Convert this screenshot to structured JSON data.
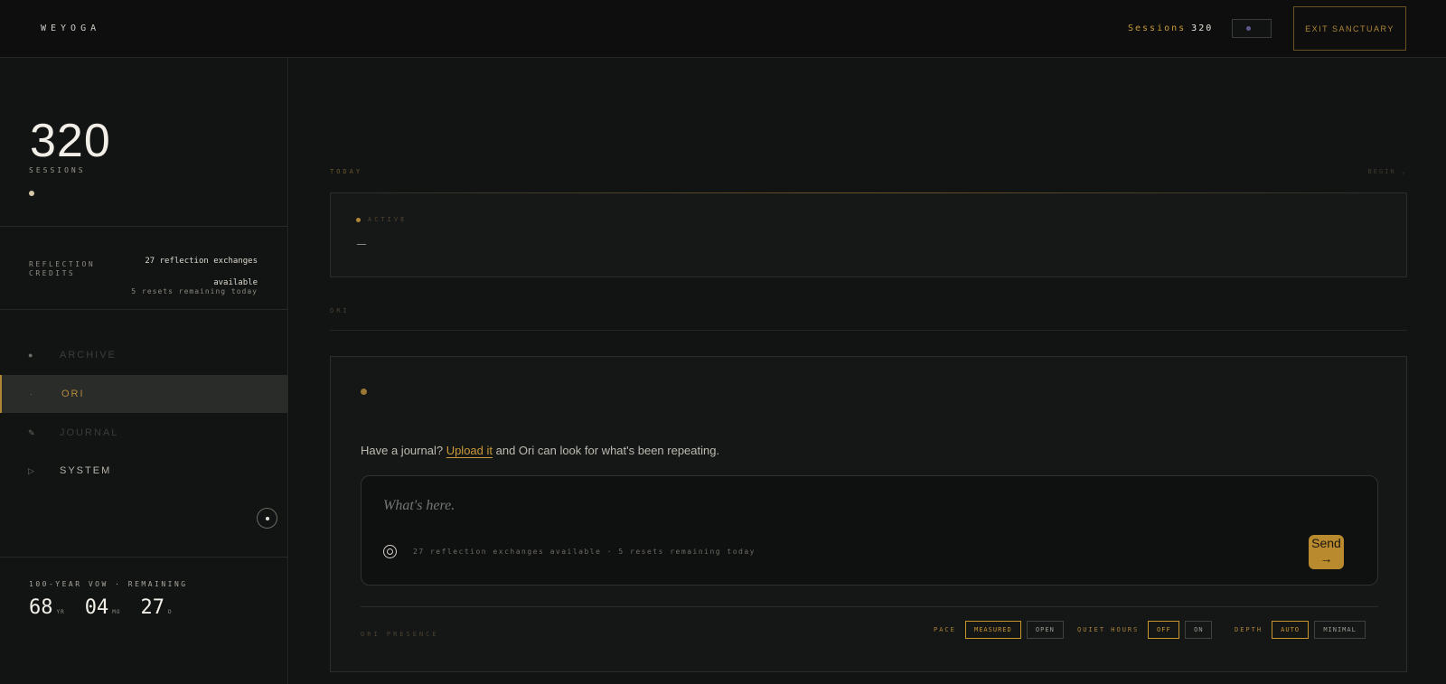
{
  "header": {
    "brand": "WEYOGA",
    "sessions_label": "Sessions",
    "sessions_value": "320",
    "exit_label": "EXIT SANCTUARY"
  },
  "sidebar": {
    "sessions_count": "320",
    "sessions_label": "SESSIONS",
    "credits": {
      "label": "REFLECTION CREDITS",
      "value": "27 reflection exchanges available",
      "resets": "5 resets remaining today"
    },
    "nav": [
      {
        "label": "ARCHIVE",
        "icon": "dot-icon",
        "state": "disabled"
      },
      {
        "label": "ORI",
        "icon": "small-dot-icon",
        "state": "active"
      },
      {
        "label": "JOURNAL",
        "icon": "pen-icon",
        "state": "disabled"
      },
      {
        "label": "SYSTEM",
        "icon": "play-icon",
        "state": "normal"
      }
    ],
    "vow": {
      "label": "100-YEAR VOW · REMAINING",
      "years": "68",
      "years_unit": "YR",
      "months": "04",
      "months_unit": "MO",
      "days": "27",
      "days_unit": "D"
    }
  },
  "main": {
    "today_label": "TODAY",
    "begin_label": "BEGIN ⌄",
    "active_label": "ACTIVE",
    "ori_label": "ORI",
    "upload": {
      "prefix": "Have a journal?",
      "link": "Upload it",
      "suffix": "and Ori can look for what's been repeating."
    },
    "composer": {
      "placeholder": "What's here.",
      "meta": "27 reflection exchanges available · 5 resets remaining today",
      "send_label": "Send",
      "send_arrow": "→"
    },
    "presence_label": "ORI PRESENCE",
    "settings": {
      "pace": {
        "label": "PACE",
        "options": [
          "MEASURED",
          "OPEN"
        ],
        "selected": "MEASURED"
      },
      "quiet_hours": {
        "label": "QUIET HOURS",
        "options": [
          "OFF",
          "ON"
        ],
        "selected": "OFF"
      },
      "depth": {
        "label": "DEPTH",
        "options": [
          "AUTO",
          "MINIMAL"
        ],
        "selected": "AUTO"
      }
    }
  },
  "colors": {
    "accent": "#c99a3a",
    "background": "#121413",
    "topbar": "#0d0e0d"
  }
}
